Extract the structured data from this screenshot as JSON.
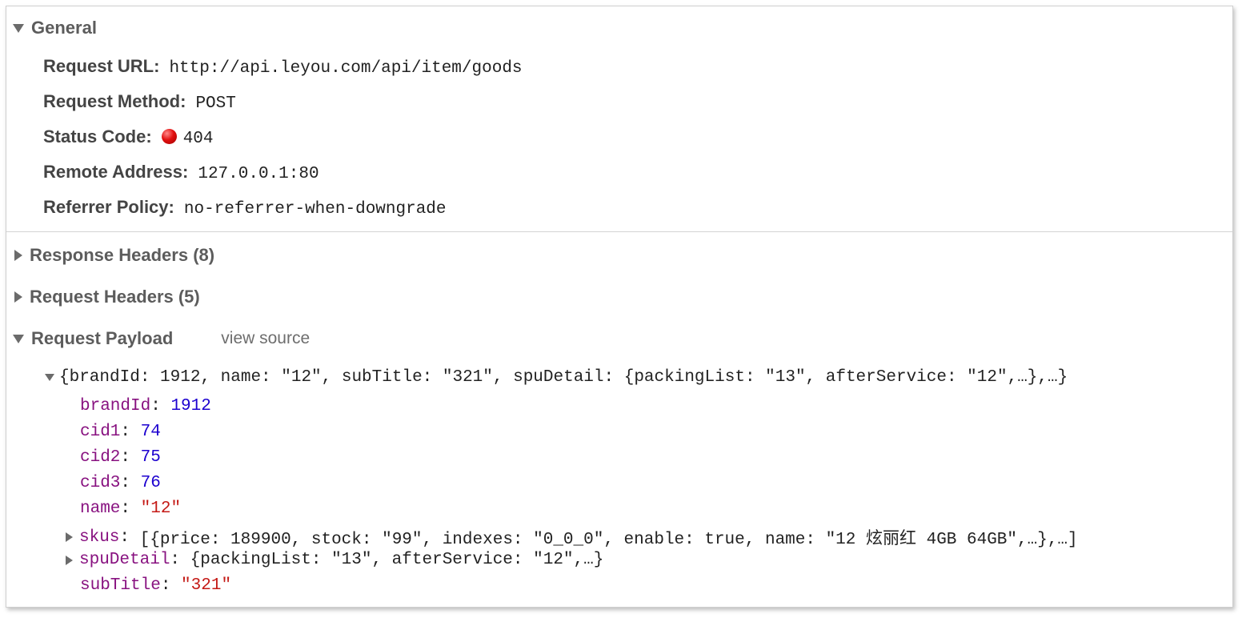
{
  "general": {
    "title": "General",
    "rows": [
      {
        "key": "Request URL:",
        "value": "http://api.leyou.com/api/item/goods"
      },
      {
        "key": "Request Method:",
        "value": "POST"
      },
      {
        "key": "Status Code:",
        "value": "404"
      },
      {
        "key": "Remote Address:",
        "value": "127.0.0.1:80"
      },
      {
        "key": "Referrer Policy:",
        "value": "no-referrer-when-downgrade"
      }
    ]
  },
  "response_headers": {
    "title": "Response Headers (8)"
  },
  "request_headers": {
    "title": "Request Headers (5)"
  },
  "request_payload": {
    "title": "Request Payload",
    "view_source": "view source",
    "summary": "{brandId: 1912, name: \"12\", subTitle: \"321\", spuDetail: {packingList: \"13\", afterService: \"12\",…},…}",
    "fields": [
      {
        "key": "brandId",
        "value": "1912",
        "kind": "number"
      },
      {
        "key": "cid1",
        "value": "74",
        "kind": "number"
      },
      {
        "key": "cid2",
        "value": "75",
        "kind": "number"
      },
      {
        "key": "cid3",
        "value": "76",
        "kind": "number"
      },
      {
        "key": "name",
        "value": "\"12\"",
        "kind": "string"
      },
      {
        "key": "skus",
        "value": "[{price: 189900, stock: \"99\", indexes: \"0_0_0\", enable: true, name: \"12 炫丽红 4GB 64GB\",…},…]",
        "kind": "object"
      },
      {
        "key": "spuDetail",
        "value": "{packingList: \"13\", afterService: \"12\",…}",
        "kind": "object"
      },
      {
        "key": "subTitle",
        "value": "\"321\"",
        "kind": "string"
      }
    ]
  },
  "colors": {
    "status_error": "#e21010",
    "json_key": "#881280",
    "json_number": "#1c00cf",
    "json_string": "#c41a16"
  },
  "icons": {
    "expanded": "triangle-down-icon",
    "collapsed": "triangle-right-icon",
    "status": "red-dot-icon"
  }
}
